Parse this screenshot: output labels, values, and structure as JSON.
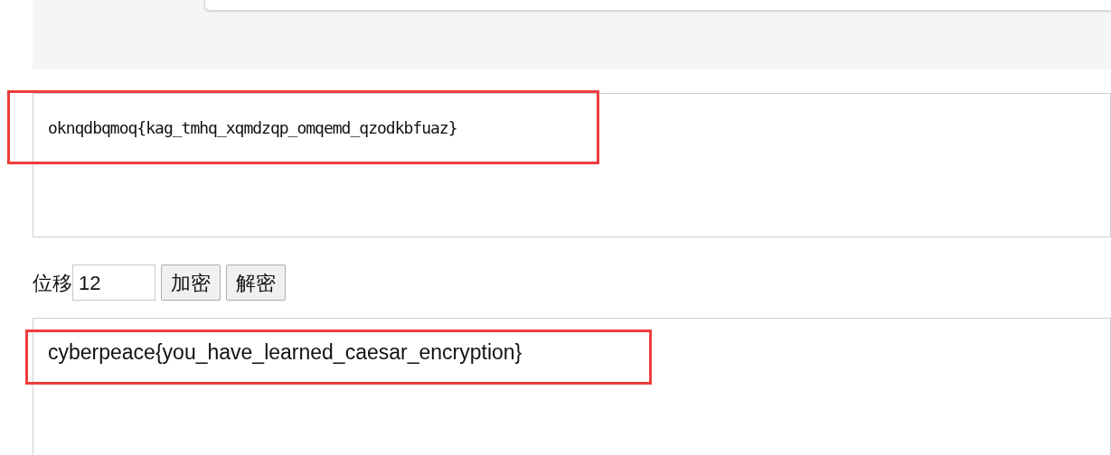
{
  "input_box": {
    "value": "oknqdbqmoq{kag_tmhq_xqmdzqp_omqemd_qzodkbfuaz}",
    "highlighted": true
  },
  "controls": {
    "shift_label": "位移",
    "shift_value": "12",
    "buttons": [
      "加密",
      "解密"
    ]
  },
  "output_box": {
    "value": "cyberpeace{you_have_learned_caesar_encryption}",
    "highlighted": true
  }
}
